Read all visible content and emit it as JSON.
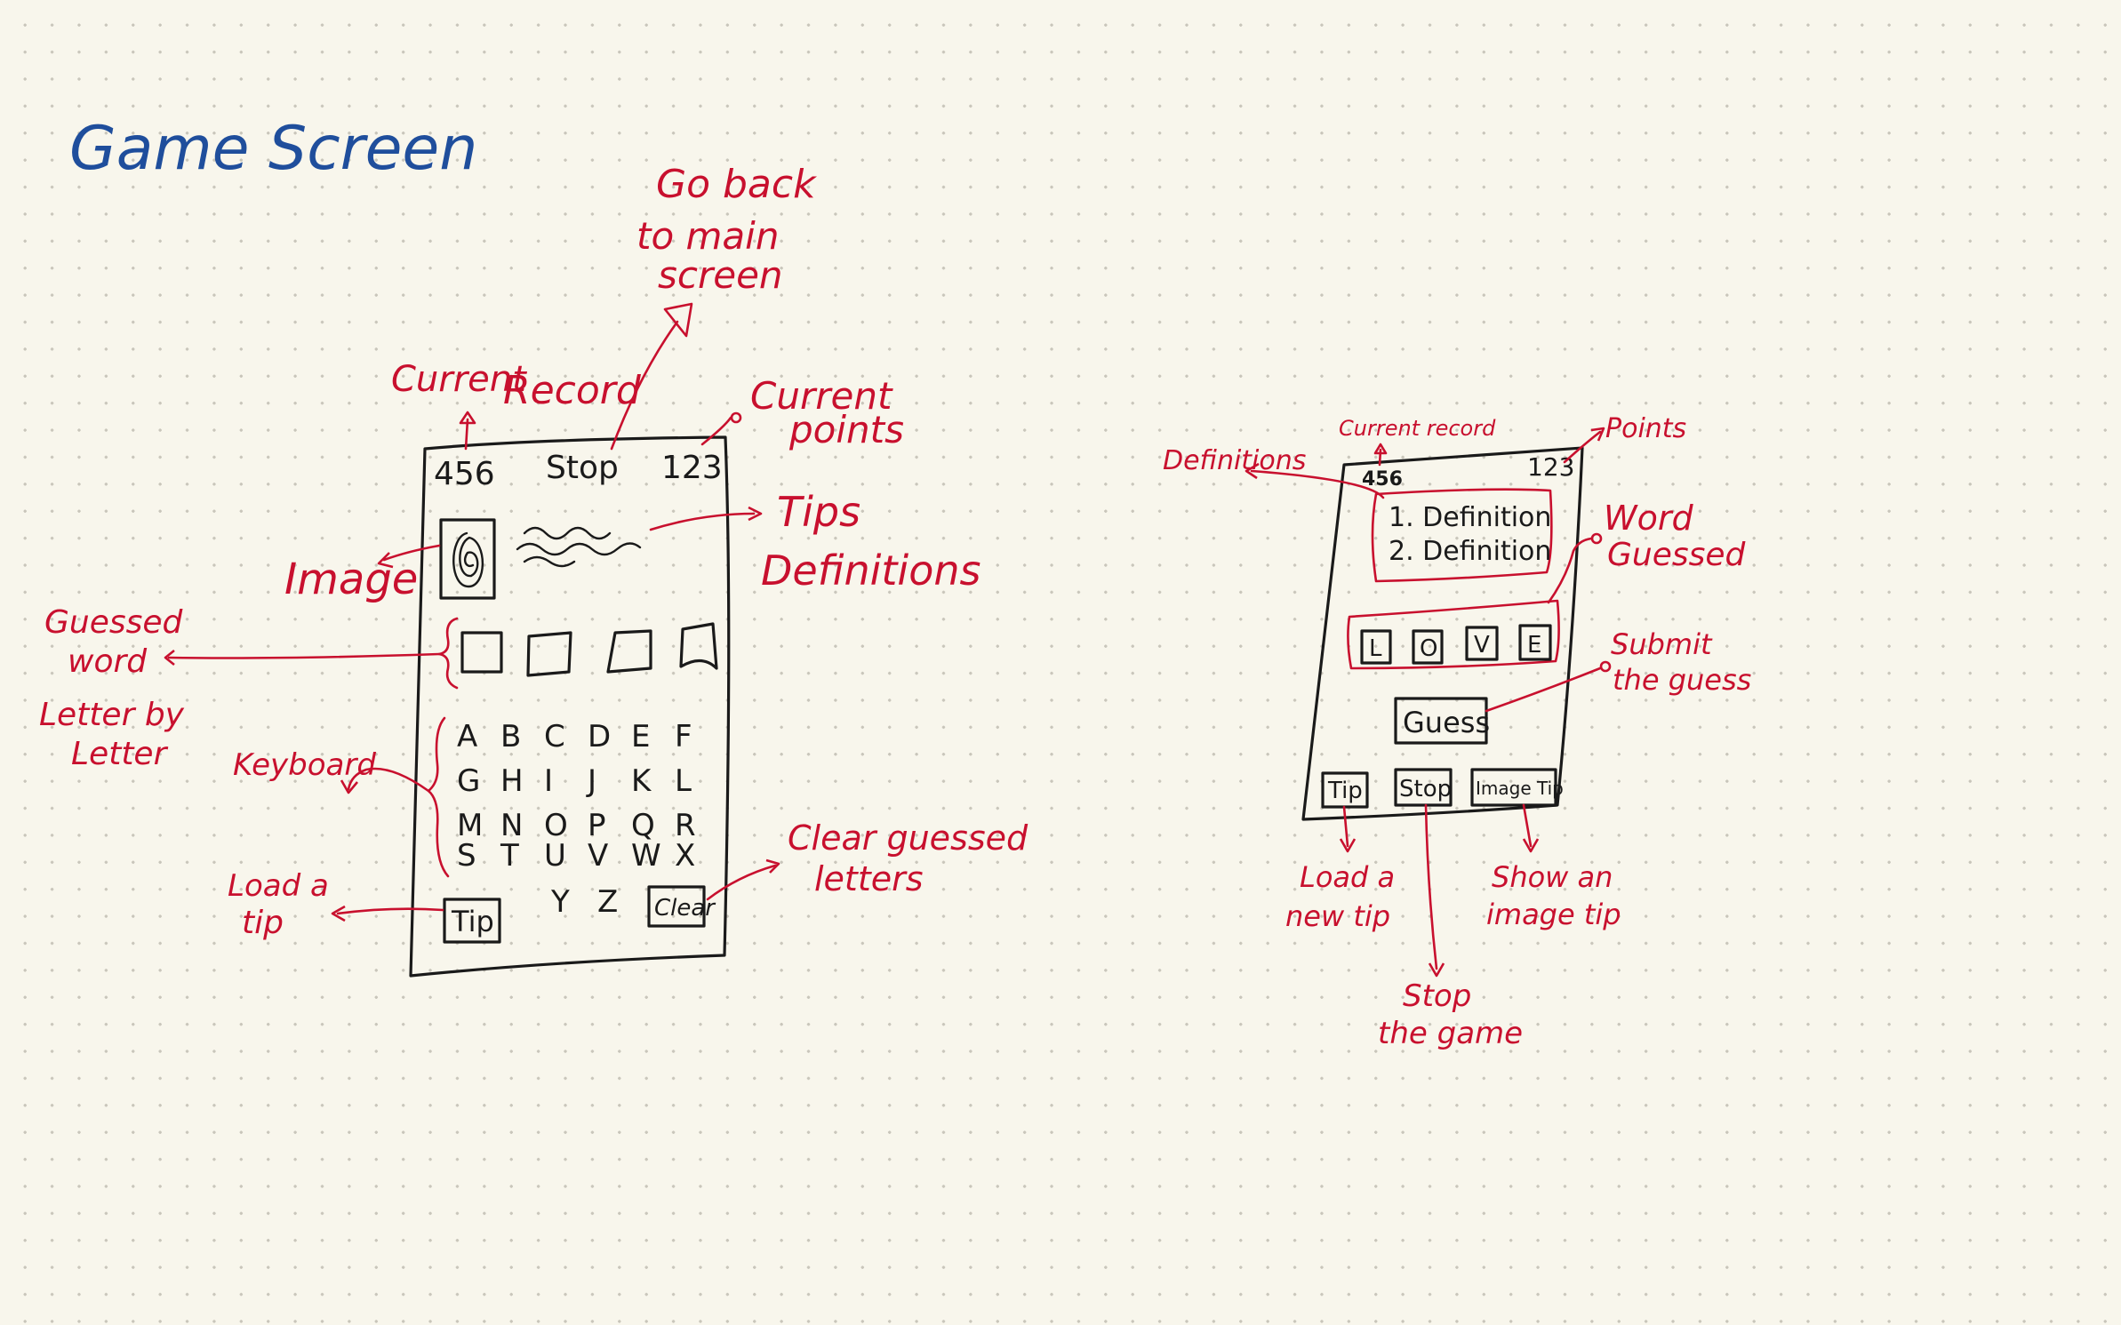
{
  "title": "Game Screen",
  "colors": {
    "paper": "#f8f6ec",
    "ink": "#1a1a1a",
    "annotation": "#c8102e",
    "title": "#1f4e9c"
  },
  "sketch1": {
    "record": "456",
    "stop": "Stop",
    "points": "123",
    "keyboard_rows": [
      [
        "A",
        "B",
        "C",
        "D",
        "E",
        "F"
      ],
      [
        "G",
        "H",
        "I",
        "J",
        "K",
        "L"
      ],
      [
        "M",
        "N",
        "O",
        "P",
        "Q",
        "R"
      ],
      [
        "S",
        "T",
        "U",
        "V",
        "W",
        "X"
      ],
      [
        "Y",
        "Z"
      ]
    ],
    "tip_button": "Tip",
    "clear_button": "Clear",
    "annotations": {
      "go_back": [
        "Go back",
        "to main",
        "screen"
      ],
      "current_record": [
        "Current",
        "Record"
      ],
      "current_points": [
        "Current",
        "points"
      ],
      "tips": [
        "Tips",
        "Definitions"
      ],
      "image": "Image",
      "guessed_word": [
        "Guessed",
        "word",
        "Letter by",
        "Letter"
      ],
      "keyboard": "Keyboard",
      "load_tip": [
        "Load a",
        "tip"
      ],
      "clear_letters": [
        "Clear guessed",
        "letters"
      ]
    }
  },
  "sketch2": {
    "record": "456",
    "points": "123",
    "definitions": [
      "1. Definition",
      "2. Definition"
    ],
    "letters": [
      "L",
      "O",
      "V",
      "E"
    ],
    "guess_button": "Guess",
    "tip_button": "Tip",
    "stop_button": "Stop",
    "image_tip_button": "Image Tip",
    "annotations": {
      "current_record": "Current record",
      "points": "Points",
      "definitions": "Definitions",
      "word_guessed": [
        "Word",
        "Guessed"
      ],
      "submit": [
        "Submit",
        "the guess"
      ],
      "load_tip": [
        "Load a",
        "new tip"
      ],
      "stop_game": [
        "Stop",
        "the game"
      ],
      "image_tip": [
        "Show an",
        "image tip"
      ]
    }
  }
}
